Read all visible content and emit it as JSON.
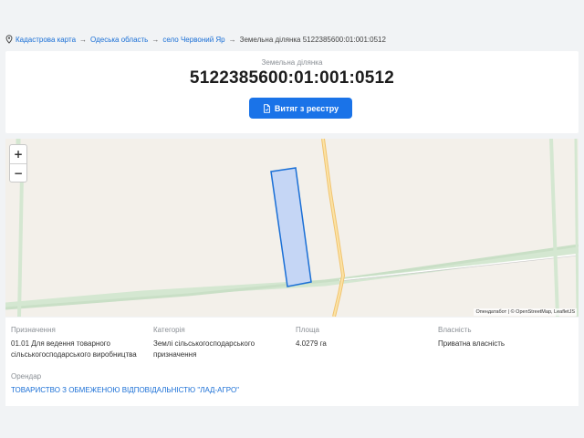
{
  "breadcrumb": {
    "items": [
      "Кадастрова карта",
      "Одеська область",
      "село Червоний Яр"
    ],
    "current": "Земельна ділянка 5122385600:01:001:0512",
    "separator": "→"
  },
  "header": {
    "kicker": "Земельна ділянка",
    "cadastral_number": "5122385600:01:001:0512",
    "extract_button": "Витяг з реєстру"
  },
  "map": {
    "zoom_in": "+",
    "zoom_out": "−",
    "attribution": "Опендатабот | © OpenStreetMap, LeafletJS",
    "parcel_fill": "#c5d6f5",
    "parcel_stroke": "#1a6fd6"
  },
  "details": {
    "purpose": {
      "label": "Призначення",
      "value": "01.01 Для ведення товарного сільськогосподарського виробництва"
    },
    "category": {
      "label": "Категорія",
      "value": "Землі сільськогосподарського призначення"
    },
    "area": {
      "label": "Площа",
      "value": "4.0279 га"
    },
    "ownership": {
      "label": "Власність",
      "value": "Приватна власність"
    },
    "tenant": {
      "label": "Орендар",
      "value": "ТОВАРИСТВО З ОБМЕЖЕНОЮ ВІДПОВІДАЛЬНІСТЮ \"ЛАД-АГРО\""
    }
  },
  "colors": {
    "accent": "#1a73e8",
    "link": "#1a6fd6"
  }
}
